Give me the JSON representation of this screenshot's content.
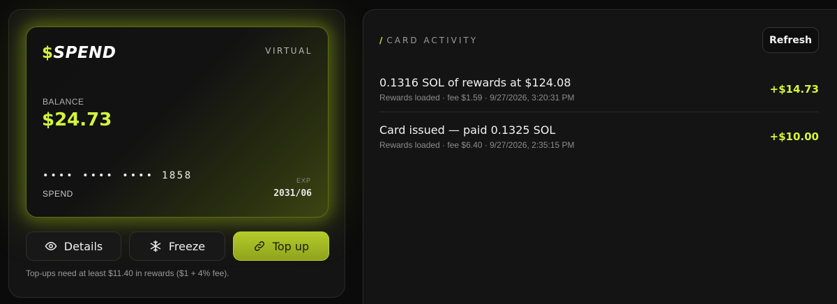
{
  "card": {
    "brand_symbol": "$",
    "brand_name": "SPEND",
    "type": "VIRTUAL",
    "balance_label": "BALANCE",
    "balance": "$24.73",
    "masked_number": "•••• •••• ••••",
    "last4": "1858",
    "holder": "SPEND",
    "exp_label": "EXP",
    "exp_value": "2031/06"
  },
  "actions": {
    "details_label": "Details",
    "freeze_label": "Freeze",
    "topup_label": "Top up",
    "hint": "Top-ups need at least $11.40 in rewards ($1 + 4% fee)."
  },
  "activity": {
    "title": "CARD ACTIVITY",
    "refresh_label": "Refresh",
    "items": [
      {
        "title": "0.1316 SOL of rewards at $124.08",
        "subtitle": "Rewards loaded · fee $1.59 · 9/27/2026, 3:20:31 PM",
        "amount": "+$14.73"
      },
      {
        "title": "Card issued — paid 0.1325 SOL",
        "subtitle": "Rewards loaded · fee $6.40 · 9/27/2026, 2:35:15 PM",
        "amount": "+$10.00"
      }
    ]
  },
  "colors": {
    "accent": "#d4f53c",
    "background": "#0b0b0b",
    "panel": "#141414"
  },
  "icons": {
    "details": "eye-icon",
    "freeze": "snowflake-icon",
    "topup": "link-icon"
  }
}
